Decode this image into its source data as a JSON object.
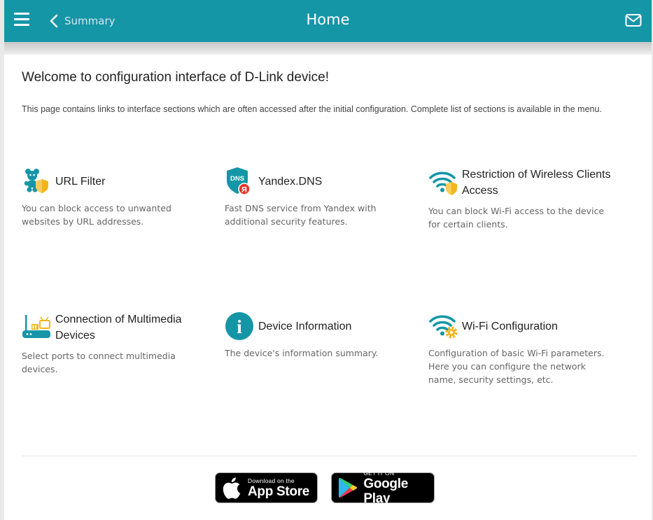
{
  "header": {
    "back_label": "Summary",
    "title": "Home",
    "bg_color": "#1596a7"
  },
  "main": {
    "welcome": "Welcome to configuration interface of D-Link device!",
    "description": "This page contains links to interface sections which are often accessed after the initial configuration. Complete list of sections is available in the menu."
  },
  "tiles": [
    {
      "title": "URL Filter",
      "text": "You can block access to unwanted websites by URL addresses.",
      "icon": "url-filter-icon"
    },
    {
      "title": "Yandex.DNS",
      "text": "Fast DNS service from Yandex with additional security features.",
      "icon": "yandex-dns-icon",
      "icon_text": "DNS",
      "badge_text": "Я"
    },
    {
      "title": "Restriction of Wireless Clients Access",
      "text": "You can block Wi-Fi access to the device for certain clients.",
      "icon": "wifi-shield-icon"
    },
    {
      "title": "Connection of Multimedia Devices",
      "text": "Select ports to connect multimedia devices.",
      "icon": "multimedia-icon"
    },
    {
      "title": "Device Information",
      "text": "The device's information summary.",
      "icon": "info-icon",
      "icon_text": "i"
    },
    {
      "title": "Wi-Fi Configuration",
      "text": "Configuration of basic Wi-Fi parameters. Here you can configure the network name, security settings, etc.",
      "icon": "wifi-gear-icon"
    }
  ],
  "stores": {
    "apple_small": "Download on the",
    "apple_big": "App Store",
    "google_small": "GET IT ON",
    "google_big": "Google Play"
  },
  "colors": {
    "accent": "#1596a7",
    "shield": "#f3b51b",
    "yandex_red": "#e7352b"
  }
}
